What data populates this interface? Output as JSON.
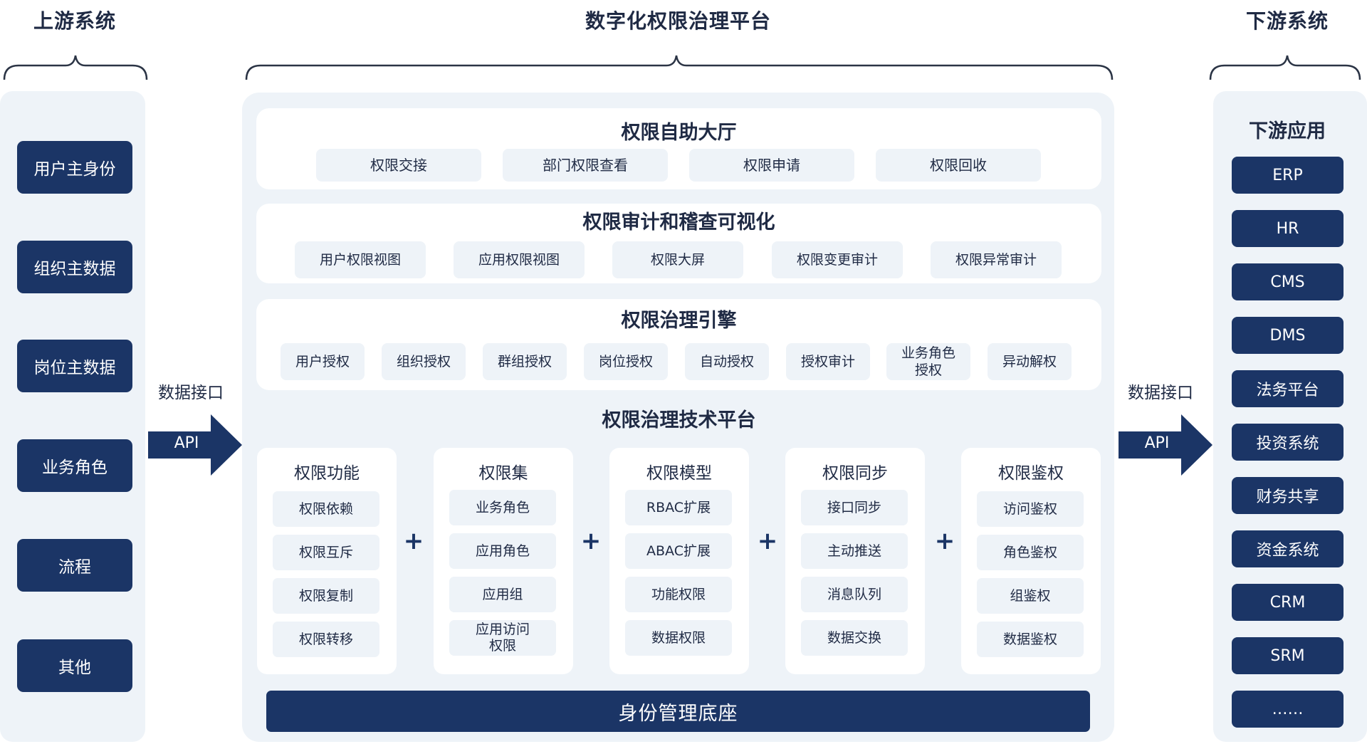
{
  "headers": {
    "upstream": "上游系统",
    "platform": "数字化权限治理平台",
    "downstream": "下游系统"
  },
  "upstream_items": [
    "用户主身份",
    "组织主数据",
    "岗位主数据",
    "业务角色",
    "流程",
    "其他"
  ],
  "api_left": {
    "label": "数据接口",
    "arrow_text": "API"
  },
  "api_right": {
    "label": "数据接口",
    "arrow_text": "API"
  },
  "self_service": {
    "title": "权限自助大厅",
    "items": [
      "权限交接",
      "部门权限查看",
      "权限申请",
      "权限回收"
    ]
  },
  "audit": {
    "title": "权限审计和稽查可视化",
    "items": [
      "用户权限视图",
      "应用权限视图",
      "权限大屏",
      "权限变更审计",
      "权限异常审计"
    ]
  },
  "engine": {
    "title": "权限治理引擎",
    "items": [
      "用户授权",
      "组织授权",
      "群组授权",
      "岗位授权",
      "自动授权",
      "授权审计",
      "业务角色\n授权",
      "异动解权"
    ]
  },
  "tech": {
    "title": "权限治理技术平台",
    "columns": [
      {
        "title": "权限功能",
        "items": [
          "权限依赖",
          "权限互斥",
          "权限复制",
          "权限转移"
        ]
      },
      {
        "title": "权限集",
        "items": [
          "业务角色",
          "应用角色",
          "应用组",
          "应用访问\n权限"
        ]
      },
      {
        "title": "权限模型",
        "items": [
          "RBAC扩展",
          "ABAC扩展",
          "功能权限",
          "数据权限"
        ]
      },
      {
        "title": "权限同步",
        "items": [
          "接口同步",
          "主动推送",
          "消息队列",
          "数据交换"
        ]
      },
      {
        "title": "权限鉴权",
        "items": [
          "访问鉴权",
          "角色鉴权",
          "组鉴权",
          "数据鉴权"
        ]
      }
    ],
    "plus_symbol": "+"
  },
  "base": "身份管理底座",
  "downstream": {
    "title": "下游应用",
    "items": [
      "ERP",
      "HR",
      "CMS",
      "DMS",
      "法务平台",
      "投资系统",
      "财务共享",
      "资金系统",
      "CRM",
      "SRM",
      "……"
    ]
  },
  "colors": {
    "navy": "#1b3566",
    "panel": "#eef3f8",
    "text": "#1f2a44"
  }
}
